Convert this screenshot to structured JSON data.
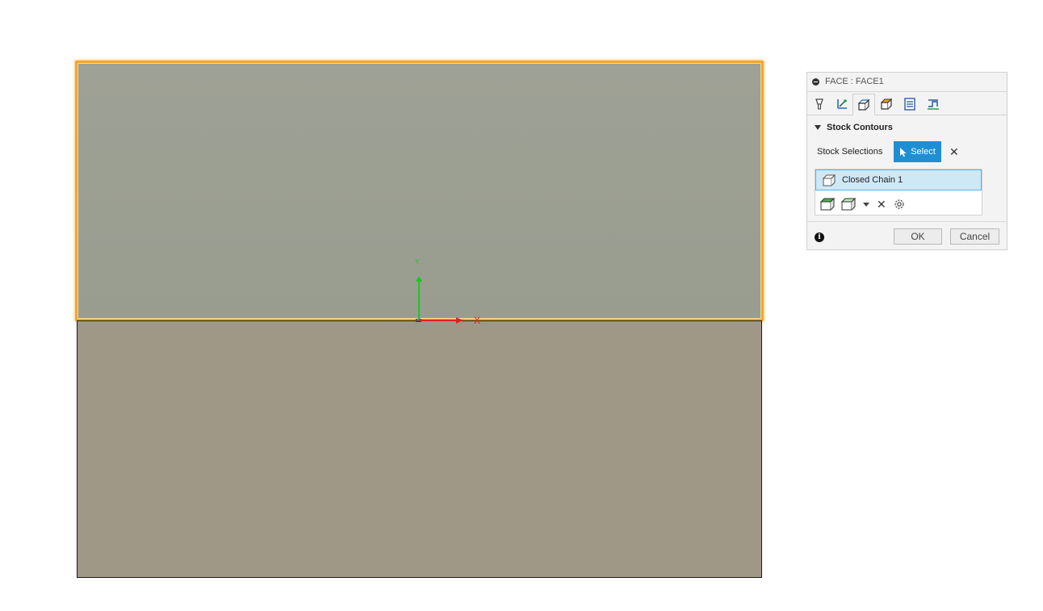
{
  "viewport": {
    "axis_labels": {
      "y": "Y",
      "x": "X"
    }
  },
  "dialog": {
    "title": "FACE : FACE1",
    "tabs": [
      {
        "icon": "tool-icon"
      },
      {
        "icon": "geometry-icon"
      },
      {
        "icon": "heights-icon",
        "active": true
      },
      {
        "icon": "passes-icon"
      },
      {
        "icon": "linking-icon"
      },
      {
        "icon": "stepover-icon"
      }
    ],
    "section_title": "Stock Contours",
    "stock_selections_label": "Stock Selections",
    "select_button_label": "Select",
    "clear_label": "✕",
    "list_items": [
      "Closed Chain 1"
    ],
    "list_tools": {
      "remove": "✕"
    },
    "ok_label": "OK",
    "cancel_label": "Cancel",
    "info_label": "i",
    "colors": {
      "accent": "#1f8fd4",
      "selection_highlight": "#f5a623",
      "list_selected": "#cfe8f6"
    }
  }
}
